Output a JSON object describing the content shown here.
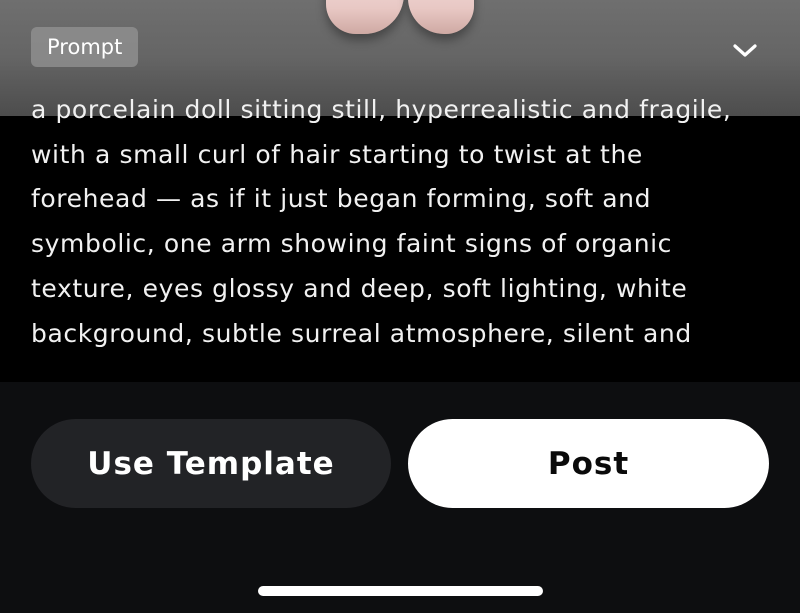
{
  "prompt": {
    "badge_label": "Prompt",
    "text": "a porcelain doll sitting still, hyperrealistic and fragile, with a small curl of hair starting to twist at the forehead — as if it just began forming, soft and symbolic, one arm showing faint signs of organic texture, eyes glossy and deep, soft lighting, white background, subtle surreal atmosphere, silent and",
    "collapse_icon": "chevron-down-icon"
  },
  "actions": {
    "use_template_label": "Use Template",
    "post_label": "Post"
  },
  "colors": {
    "background": "#0d0e10",
    "panel": "#000000",
    "secondary_button": "#222326",
    "primary_button": "#ffffff"
  }
}
